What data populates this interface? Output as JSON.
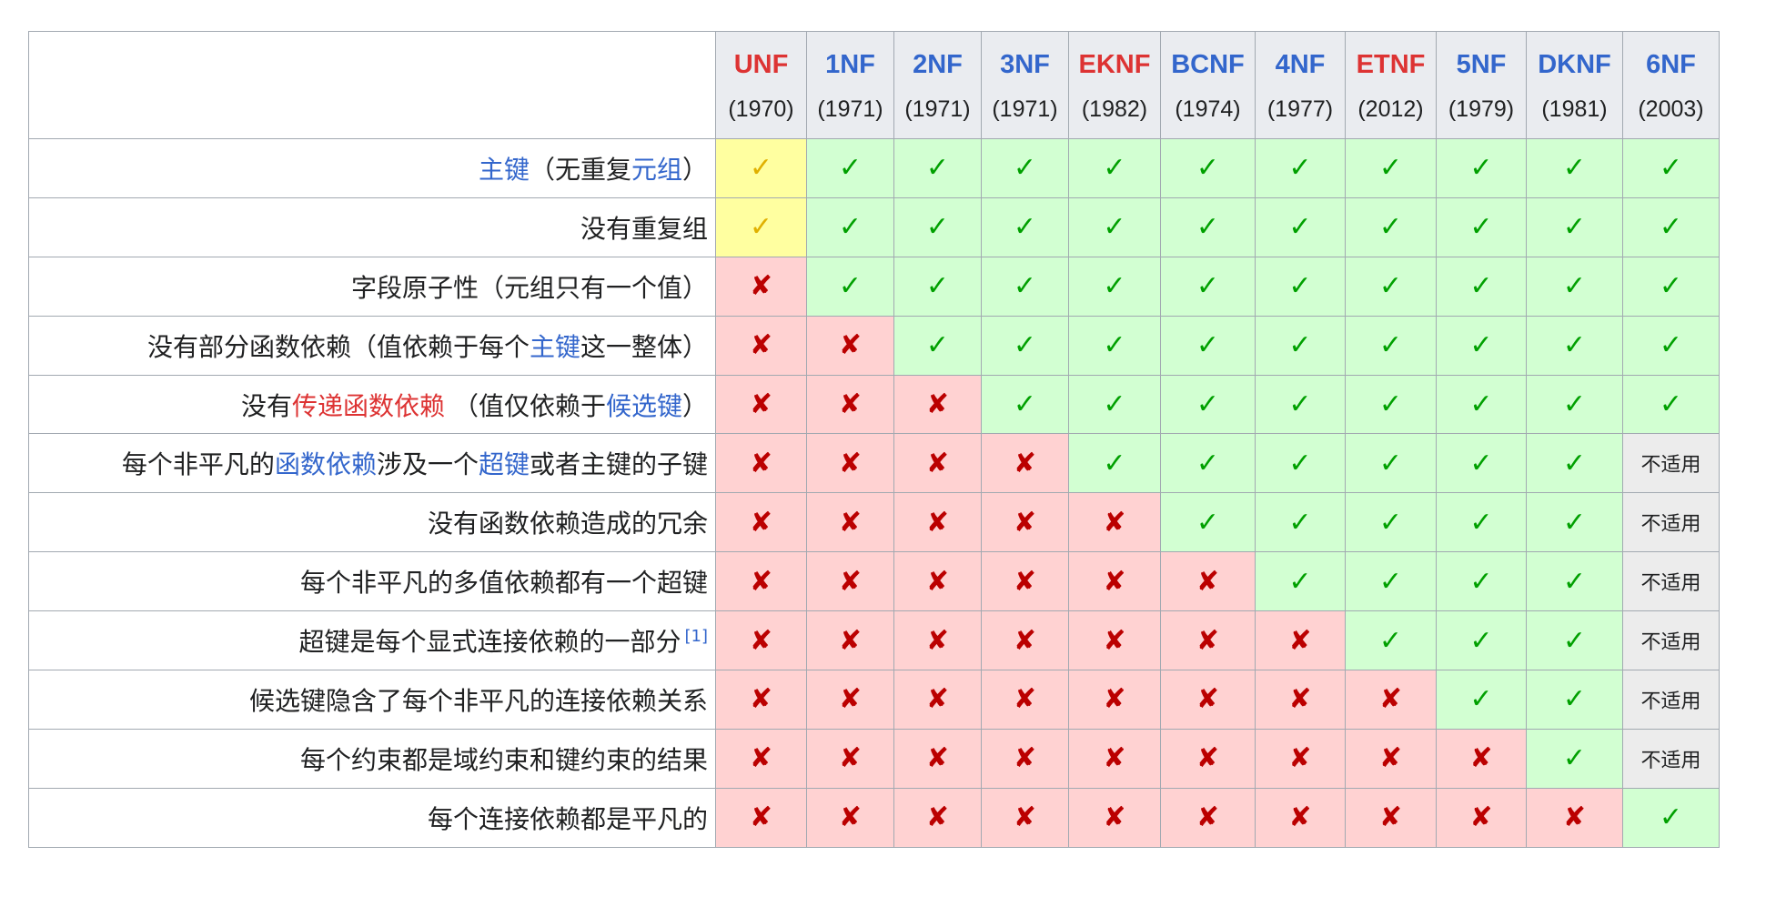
{
  "columns": [
    {
      "name": "UNF",
      "year": "(1970)",
      "color": "#dd3333"
    },
    {
      "name": "1NF",
      "year": "(1971)",
      "color": "#3366cc"
    },
    {
      "name": "2NF",
      "year": "(1971)",
      "color": "#3366cc"
    },
    {
      "name": "3NF",
      "year": "(1971)",
      "color": "#3366cc"
    },
    {
      "name": "EKNF",
      "year": "(1982)",
      "color": "#dd3333"
    },
    {
      "name": "BCNF",
      "year": "(1974)",
      "color": "#3366cc"
    },
    {
      "name": "4NF",
      "year": "(1977)",
      "color": "#3366cc"
    },
    {
      "name": "ETNF",
      "year": "(2012)",
      "color": "#dd3333"
    },
    {
      "name": "5NF",
      "year": "(1979)",
      "color": "#3366cc"
    },
    {
      "name": "DKNF",
      "year": "(1981)",
      "color": "#3366cc"
    },
    {
      "name": "6NF",
      "year": "(2003)",
      "color": "#3366cc"
    }
  ],
  "symbols": {
    "yes": "✓",
    "no": "✘",
    "na": "不适用"
  },
  "colors": {
    "yes_bg": "#d2ffd2",
    "no_bg": "#ffd2d2",
    "partial_bg": "#ffffa0",
    "na_bg": "#ececec",
    "link": "#3366cc",
    "redlink": "#dd3333"
  },
  "rows": [
    {
      "label": [
        {
          "t": "主键",
          "c": "blue"
        },
        {
          "t": "（无重复"
        },
        {
          "t": "元组",
          "c": "blue"
        },
        {
          "t": "）"
        }
      ],
      "values": [
        "part",
        "yes",
        "yes",
        "yes",
        "yes",
        "yes",
        "yes",
        "yes",
        "yes",
        "yes",
        "yes"
      ]
    },
    {
      "label": [
        {
          "t": "没有重复组"
        }
      ],
      "values": [
        "part",
        "yes",
        "yes",
        "yes",
        "yes",
        "yes",
        "yes",
        "yes",
        "yes",
        "yes",
        "yes"
      ]
    },
    {
      "label": [
        {
          "t": "字段原子性（元组只有一个值）"
        }
      ],
      "values": [
        "no",
        "yes",
        "yes",
        "yes",
        "yes",
        "yes",
        "yes",
        "yes",
        "yes",
        "yes",
        "yes"
      ]
    },
    {
      "label": [
        {
          "t": "没有部分函数依赖（值依赖于每个"
        },
        {
          "t": "主键",
          "c": "blue"
        },
        {
          "t": "这一整体）"
        }
      ],
      "values": [
        "no",
        "no",
        "yes",
        "yes",
        "yes",
        "yes",
        "yes",
        "yes",
        "yes",
        "yes",
        "yes"
      ]
    },
    {
      "label": [
        {
          "t": "没有"
        },
        {
          "t": "传递函数依赖",
          "c": "red"
        },
        {
          "t": " （值仅依赖于"
        },
        {
          "t": "候选键",
          "c": "blue"
        },
        {
          "t": "）"
        }
      ],
      "values": [
        "no",
        "no",
        "no",
        "yes",
        "yes",
        "yes",
        "yes",
        "yes",
        "yes",
        "yes",
        "yes"
      ]
    },
    {
      "label": [
        {
          "t": "每个非平凡的"
        },
        {
          "t": "函数依赖",
          "c": "blue"
        },
        {
          "t": "涉及一个"
        },
        {
          "t": "超键",
          "c": "blue"
        },
        {
          "t": "或者主键的子键"
        }
      ],
      "values": [
        "no",
        "no",
        "no",
        "no",
        "yes",
        "yes",
        "yes",
        "yes",
        "yes",
        "yes",
        "na"
      ]
    },
    {
      "label": [
        {
          "t": "没有函数依赖造成的冗余"
        }
      ],
      "values": [
        "no",
        "no",
        "no",
        "no",
        "no",
        "yes",
        "yes",
        "yes",
        "yes",
        "yes",
        "na"
      ]
    },
    {
      "label": [
        {
          "t": "每个非平凡的多值依赖都有一个超键"
        }
      ],
      "values": [
        "no",
        "no",
        "no",
        "no",
        "no",
        "no",
        "yes",
        "yes",
        "yes",
        "yes",
        "na"
      ]
    },
    {
      "label": [
        {
          "t": "超键是每个显式连接依赖的一部分"
        }
      ],
      "sup": "[1]",
      "values": [
        "no",
        "no",
        "no",
        "no",
        "no",
        "no",
        "no",
        "yes",
        "yes",
        "yes",
        "na"
      ]
    },
    {
      "label": [
        {
          "t": "候选键隐含了每个非平凡的连接依赖关系"
        }
      ],
      "values": [
        "no",
        "no",
        "no",
        "no",
        "no",
        "no",
        "no",
        "no",
        "yes",
        "yes",
        "na"
      ]
    },
    {
      "label": [
        {
          "t": "每个约束都是域约束和键约束的结果"
        }
      ],
      "values": [
        "no",
        "no",
        "no",
        "no",
        "no",
        "no",
        "no",
        "no",
        "no",
        "yes",
        "na"
      ]
    },
    {
      "label": [
        {
          "t": "每个连接依赖都是平凡的"
        }
      ],
      "values": [
        "no",
        "no",
        "no",
        "no",
        "no",
        "no",
        "no",
        "no",
        "no",
        "no",
        "yes"
      ]
    }
  ]
}
